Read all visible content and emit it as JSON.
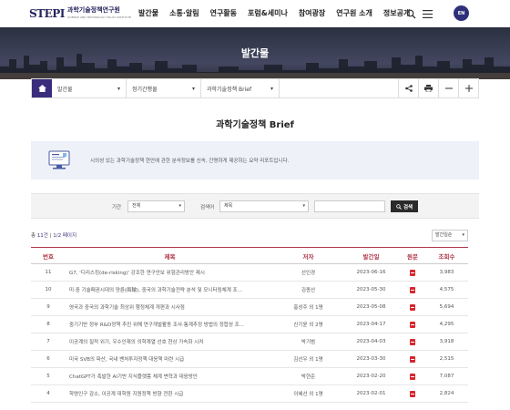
{
  "header": {
    "logo_mark": "STEPI",
    "logo_text": "과학기술정책연구원",
    "logo_sub": "SCIENCE AND TECHNOLOGY POLICY INSTITUTE",
    "nav": [
      "발간물",
      "소통·알림",
      "연구활동",
      "포럼&세미나",
      "참여광장",
      "연구원 소개",
      "정보공개"
    ],
    "lang": "EN",
    "icons": [
      "search-icon",
      "menu-icon"
    ]
  },
  "hero": {
    "title": "발간물"
  },
  "breadcrumb": {
    "items": [
      "발간물",
      "정기간행물",
      "과학기술정책 Brief"
    ],
    "tools": [
      "share-icon",
      "print-icon",
      "zoom-out-icon",
      "zoom-in-icon"
    ]
  },
  "page_title": "과학기술정책 Brief",
  "intro": {
    "text": "시의성 있는 과학기술정책 현안에 관한 분석정보를 신속, 간명하게 제공하는 요약 리포트입니다."
  },
  "search": {
    "period_label": "기간",
    "period_value": "전체",
    "field_label": "검색어",
    "field_value": "제목",
    "query": "",
    "button": "검색"
  },
  "count": {
    "total_prefix": "총",
    "total": "11건",
    "page": "1/2 페이지"
  },
  "sort": "발간일순",
  "table": {
    "headers": [
      "번호",
      "제목",
      "저자",
      "발간일",
      "원문",
      "조회수"
    ],
    "rows": [
      {
        "no": "11",
        "title": "G7, '디리스킹(de-risking)' 강조한 연구안보 위험관리방안 제시",
        "author": "선인경",
        "date": "2023-06-16",
        "views": "3,983"
      },
      {
        "no": "10",
        "title": "미·중 기술패권시대의 양륜(兩輪), 중국의 과학기술전략 분석 및 모니터링체계 조...",
        "author": "김종선",
        "date": "2023-05-30",
        "views": "4,575"
      },
      {
        "no": "9",
        "title": "영국과 중국의 과학기술 최상위 행정체계 개편과 시사점",
        "author": "홍성주 외 1명",
        "date": "2023-05-08",
        "views": "5,694"
      },
      {
        "no": "8",
        "title": "중기기반 정부 R&D정책 추진 위해 연구개발활동 조사·통계추정 방법의 정합성 조...",
        "author": "신기윤 외 2명",
        "date": "2023-04-17",
        "views": "4,295"
      },
      {
        "no": "7",
        "title": "이공계의 질적 위기, 우수인재의 의학계열 선호 현상 가속화 시켜",
        "author": "박기범",
        "date": "2023-04-03",
        "views": "3,918"
      },
      {
        "no": "6",
        "title": "미국 SVB의 파산, 국내 벤처투자정책 대응책 마련 시급",
        "author": "김선우 외 1명",
        "date": "2023-03-30",
        "views": "2,515"
      },
      {
        "no": "5",
        "title": "ChatGPT가 촉발한 AI기반 지식플랫폼 체계 변혁과 대응방안",
        "author": "박현준",
        "date": "2023-02-20",
        "views": "7,087"
      },
      {
        "no": "4",
        "title": "학령인구 감소, 이공계 대학원 지원정책 방향 전환 시급",
        "author": "이혜선 외 1명",
        "date": "2023-02-01",
        "views": "2,824"
      }
    ]
  },
  "colors": {
    "brand": "#3a2d7c",
    "accent": "#b0354a",
    "pdf": "#d7262e"
  }
}
